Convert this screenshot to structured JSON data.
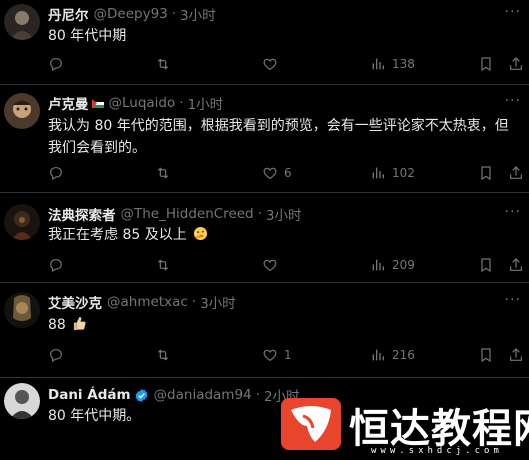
{
  "tweets": [
    {
      "display_name": "丹尼尔",
      "handle": "@Deepy93",
      "time": "3小时",
      "text": "80 年代中期",
      "stats": {
        "replies": "",
        "reposts": "",
        "likes": "",
        "views": "138"
      },
      "flag": false,
      "verified": false,
      "emoji": ""
    },
    {
      "display_name": "卢克曼",
      "handle": "@Luqaido",
      "time": "1小时",
      "text": "我认为 80 年代的范围，根据我看到的预览，会有一些评论家不太热衷，但我们会看到的。",
      "stats": {
        "replies": "",
        "reposts": "",
        "likes": "6",
        "views": "102"
      },
      "flag": true,
      "verified": false,
      "emoji": ""
    },
    {
      "display_name": "法典探索者",
      "handle": "@The_HiddenCreed",
      "time": "3小时",
      "text": "我正在考虑 85 及以上",
      "stats": {
        "replies": "",
        "reposts": "",
        "likes": "",
        "views": "209"
      },
      "flag": false,
      "verified": false,
      "emoji": "thinking-face"
    },
    {
      "display_name": "艾美沙克",
      "handle": "@ahmetxac",
      "time": "3小时",
      "text": "88",
      "stats": {
        "replies": "",
        "reposts": "",
        "likes": "1",
        "views": "216"
      },
      "flag": false,
      "verified": false,
      "emoji": "thumbs-up"
    },
    {
      "display_name": "Dani Ádám",
      "handle": "@daniadam94",
      "time": "2小时",
      "text": "80 年代中期。",
      "stats": {
        "replies": "",
        "reposts": "",
        "likes": "",
        "views": ""
      },
      "flag": false,
      "verified": true,
      "emoji": ""
    }
  ],
  "separator": "·",
  "more_glyph": "···",
  "watermark": {
    "text": "恒达教程网",
    "url": "www.sxhdcj.com"
  },
  "colors": {
    "background": "#000000",
    "text": "#e7e9ea",
    "muted": "#71767b",
    "verified": "#1d9bf0",
    "watermark_red": "#e8452c"
  }
}
